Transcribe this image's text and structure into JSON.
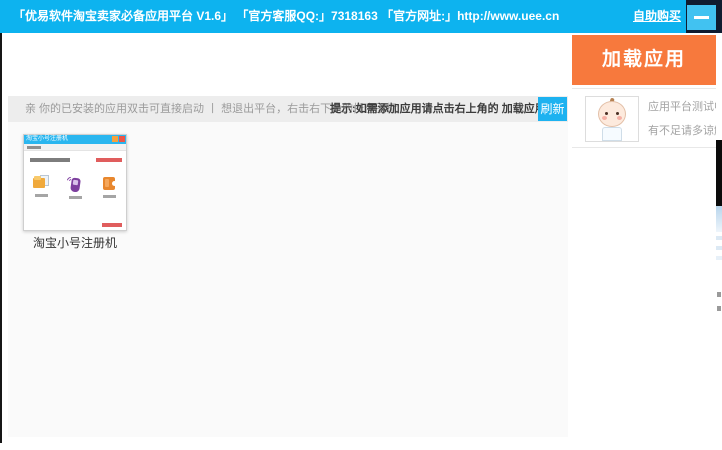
{
  "topbar": {
    "title": "「优易软件淘宝卖家必备应用平台 V1.6」 「官方客服QQ:」7318163 「官方网址:」http://www.uee.cn",
    "buy_link": "自助购买"
  },
  "hint_bar": {
    "hint": "亲 你的已安装的应用双击可直接启动 丨 想退出平台，右击右下角的托盘图标",
    "tip": "提示:如需添加应用请点击右上角的 加载应用",
    "refresh_label": "刷新"
  },
  "apps": [
    {
      "caption": "淘宝小号注册机",
      "thumb_title": "淘宝小号注册机"
    }
  ],
  "right_panel": {
    "load_app_label": "加载应用",
    "notice_line1": "应用平台测试中 ，",
    "notice_line2": "有不足请多谅解~"
  },
  "icons": {
    "minimize": "minus-bar",
    "thumb_minimize": "minus-bar",
    "thumb_close": "x",
    "app_thumb_icons": [
      "folder-icon",
      "phone-icon",
      "puzzle-icon"
    ],
    "avatar": "baby-cartoon"
  },
  "colors": {
    "topbar_cyan": "#0db3ef",
    "accent_orange": "#f7793d",
    "refresh_blue": "#1db2f0",
    "hint_bar_bg": "#ededed",
    "corner_navy": "#101c30"
  }
}
